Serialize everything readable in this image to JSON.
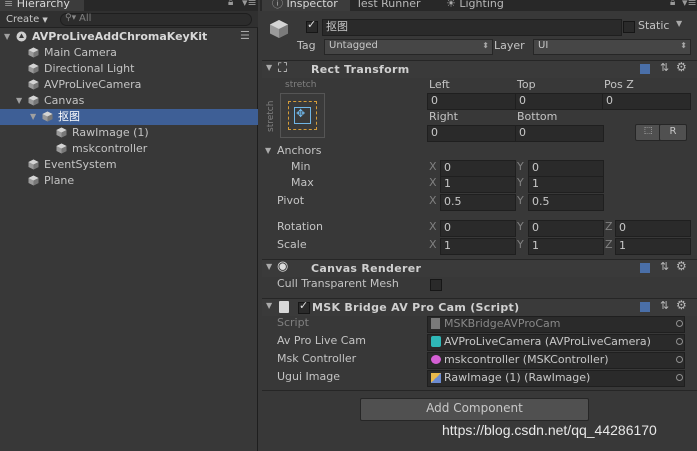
{
  "hierarchy": {
    "tab_label": "Hierarchy",
    "create_label": "Create",
    "search_placeholder": "All",
    "scene_name": "AVProLiveAddChromaKeyKit",
    "items": [
      {
        "label": "Main Camera",
        "depth": 1
      },
      {
        "label": "Directional Light",
        "depth": 1
      },
      {
        "label": "AVProLiveCamera",
        "depth": 1
      },
      {
        "label": "Canvas",
        "depth": 1,
        "expanded": true
      },
      {
        "label": "抠图",
        "depth": 2,
        "expanded": true,
        "selected": true
      },
      {
        "label": "RawImage (1)",
        "depth": 3
      },
      {
        "label": "mskcontroller",
        "depth": 3
      },
      {
        "label": "EventSystem",
        "depth": 1
      },
      {
        "label": "Plane",
        "depth": 1
      }
    ]
  },
  "inspector": {
    "tabs": [
      "Inspector",
      "Test Runner",
      "Lighting"
    ],
    "object_name": "抠图",
    "static_label": "Static",
    "tag_label": "Tag",
    "tag_value": "Untagged",
    "layer_label": "Layer",
    "layer_value": "UI",
    "rect_transform": {
      "title": "Rect Transform",
      "stretch_top": "stretch",
      "stretch_side": "stretch",
      "col_left": "Left",
      "col_top": "Top",
      "col_posz": "Pos Z",
      "left": "0",
      "top": "0",
      "posz": "0",
      "col_right": "Right",
      "col_bottom": "Bottom",
      "right": "0",
      "bottom": "0",
      "r_button": "R",
      "anchors_label": "Anchors",
      "min_label": "Min",
      "max_label": "Max",
      "min_x": "0",
      "min_y": "0",
      "max_x": "1",
      "max_y": "1",
      "pivot_label": "Pivot",
      "pivot_x": "0.5",
      "pivot_y": "0.5",
      "rotation_label": "Rotation",
      "rot_x": "0",
      "rot_y": "0",
      "rot_z": "0",
      "scale_label": "Scale",
      "scale_x": "1",
      "scale_y": "1",
      "scale_z": "1",
      "x": "X",
      "y": "Y",
      "z": "Z"
    },
    "canvas_renderer": {
      "title": "Canvas Renderer",
      "cull_label": "Cull Transparent Mesh"
    },
    "script_component": {
      "title": "MSK Bridge AV Pro Cam (Script)",
      "script_label": "Script",
      "script_value": "MSKBridgeAVProCam",
      "cam_label": "Av Pro Live Cam",
      "cam_value": "AVProLiveCamera (AVProLiveCamera)",
      "msk_label": "Msk Controller",
      "msk_value": "mskcontroller (MSKController)",
      "ugui_label": "Ugui Image",
      "ugui_value": "RawImage (1) (RawImage)"
    },
    "add_component_label": "Add Component"
  },
  "watermark": "https://blog.csdn.net/qq_44286170",
  "colors": {
    "selection": "#3e5f96",
    "panel": "#383838",
    "field": "#2a2a2a"
  }
}
